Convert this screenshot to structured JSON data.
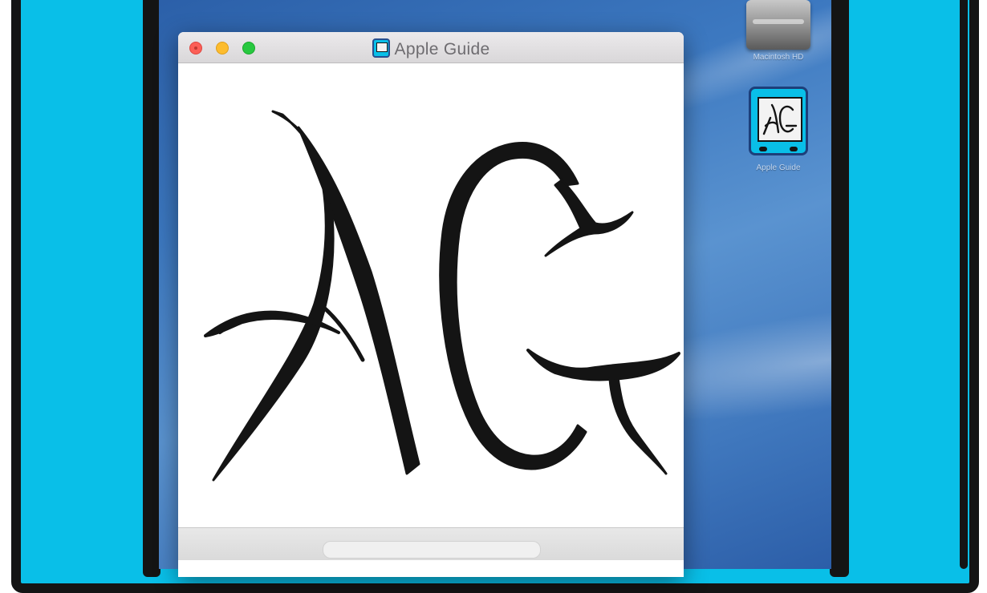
{
  "window": {
    "title": "Apple Guide",
    "traffic_lights": {
      "close": "#fc5f57",
      "minimize": "#fdbc2e",
      "zoom": "#28c840"
    }
  },
  "desktop": {
    "icons": [
      {
        "label": "Macintosh HD",
        "icon": "hard-drive-icon"
      },
      {
        "label": "Apple Guide",
        "icon": "apple-guide-app-icon"
      }
    ]
  },
  "artwork": {
    "letters": "AG"
  },
  "colors": {
    "bezel": "#09bfe8",
    "outline": "#141414",
    "desktop": "#3c78c0"
  }
}
